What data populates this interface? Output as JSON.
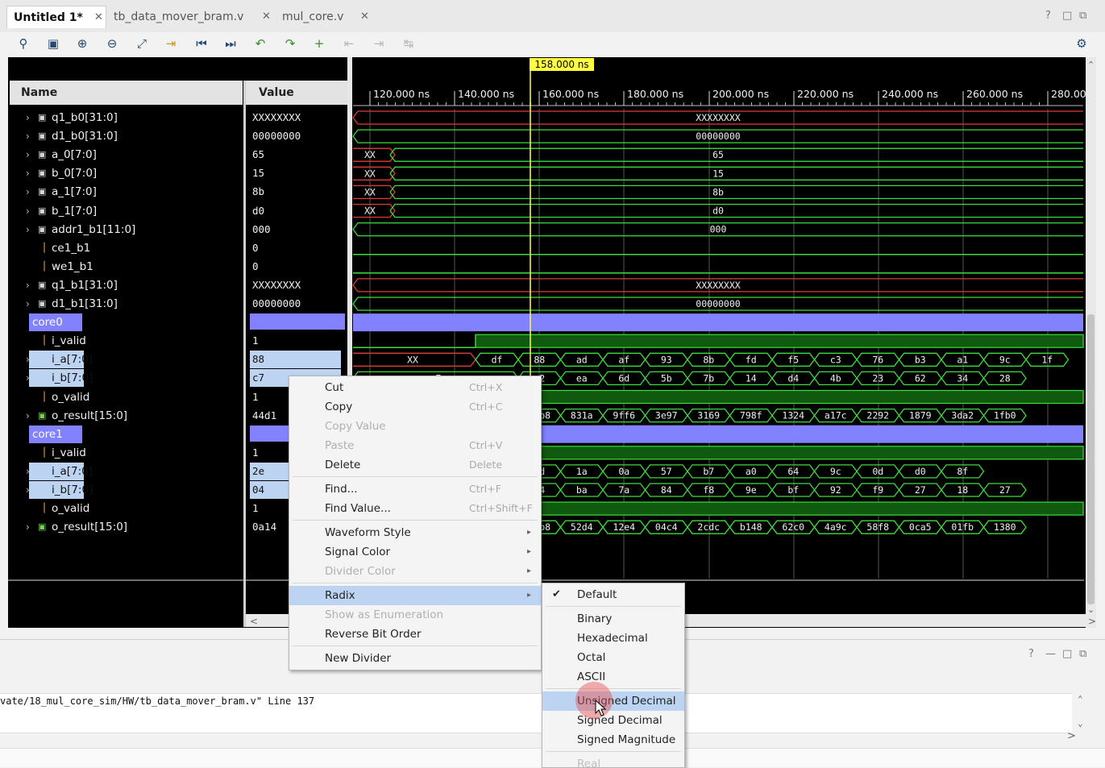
{
  "tabs": [
    {
      "label": "Untitled 1*",
      "active": true
    },
    {
      "label": "tb_data_mover_bram.v",
      "active": false
    },
    {
      "label": "mul_core.v",
      "active": false
    }
  ],
  "window_controls": {
    "help": "?",
    "minimize": "—",
    "maximize": "□",
    "restore": "⧉"
  },
  "toolbar": {
    "icons": [
      "search-icon",
      "save-icon",
      "zoom-in-icon",
      "zoom-out-icon",
      "zoom-fit-icon",
      "go-to-cursor-icon",
      "go-to-start-icon",
      "go-to-end-icon",
      "previous-transition-icon",
      "next-transition-icon",
      "add-marker-icon",
      "previous-marker-icon",
      "next-marker-icon",
      "swap-cursors-icon"
    ],
    "settings_icon": "gear-icon"
  },
  "wave": {
    "name_header": "Name",
    "value_header": "Value",
    "cursor_time": "158.000 ns",
    "ticks": [
      "120.000 ns",
      "140.000 ns",
      "160.000 ns",
      "180.000 ns",
      "200.000 ns",
      "220.000 ns",
      "240.000 ns",
      "260.000 ns",
      "280.00"
    ],
    "signals": [
      {
        "name": "q1_b0[31:0]",
        "value": "XXXXXXXX",
        "kind": "bus",
        "expand": true,
        "wave": "XXXXXXXX",
        "style": "x"
      },
      {
        "name": "d1_b0[31:0]",
        "value": "00000000",
        "kind": "bus",
        "expand": true,
        "wave": "00000000",
        "style": "bus"
      },
      {
        "name": "a_0[7:0]",
        "value": "65",
        "kind": "bus",
        "expand": true,
        "wave": "65",
        "pre": "XX",
        "style": "bus"
      },
      {
        "name": "b_0[7:0]",
        "value": "15",
        "kind": "bus",
        "expand": true,
        "wave": "15",
        "pre": "XX",
        "style": "bus"
      },
      {
        "name": "a_1[7:0]",
        "value": "8b",
        "kind": "bus",
        "expand": true,
        "wave": "8b",
        "pre": "XX",
        "style": "bus"
      },
      {
        "name": "b_1[7:0]",
        "value": "d0",
        "kind": "bus",
        "expand": true,
        "wave": "d0",
        "pre": "XX",
        "style": "bus"
      },
      {
        "name": "addr1_b1[11:0]",
        "value": "000",
        "kind": "bus",
        "expand": true,
        "wave": "000",
        "style": "bus"
      },
      {
        "name": "ce1_b1",
        "value": "0",
        "kind": "bit",
        "expand": false,
        "style": "low"
      },
      {
        "name": "we1_b1",
        "value": "0",
        "kind": "bit",
        "expand": false,
        "style": "low"
      },
      {
        "name": "q1_b1[31:0]",
        "value": "XXXXXXXX",
        "kind": "bus",
        "expand": true,
        "wave": "XXXXXXXX",
        "style": "x"
      },
      {
        "name": "d1_b1[31:0]",
        "value": "00000000",
        "kind": "bus",
        "expand": true,
        "wave": "00000000",
        "style": "bus"
      },
      {
        "name": "core0",
        "value": "",
        "kind": "divider",
        "expand": false,
        "style": "divider"
      },
      {
        "name": "i_valid",
        "value": "1",
        "kind": "bit",
        "expand": false,
        "style": "high"
      },
      {
        "name": "i_a[7:0]",
        "value": "88",
        "kind": "bus",
        "expand": true,
        "selected": true,
        "pre": "XX",
        "segs": [
          "df",
          "88",
          "ad",
          "af",
          "93",
          "8b",
          "fd",
          "f5",
          "c3",
          "76",
          "b3",
          "a1",
          "9c",
          "1f"
        ],
        "style": "segs"
      },
      {
        "name": "i_b[7:0]",
        "value": "c7",
        "kind": "bus",
        "expand": true,
        "selected": true,
        "segs": [
          "c7",
          "c2",
          "ea",
          "6d",
          "5b",
          "7b",
          "14",
          "d4",
          "4b",
          "23",
          "62",
          "34",
          "28"
        ],
        "style": "segs"
      },
      {
        "name": "o_valid",
        "value": "1",
        "kind": "bit",
        "expand": false,
        "style": "high"
      },
      {
        "name": "o_result[15:0]",
        "value": "44d1",
        "kind": "bus",
        "expand": true,
        "segs": [
          "44d1",
          "69b8",
          "831a",
          "9ff6",
          "3e97",
          "3169",
          "798f",
          "1324",
          "a17c",
          "2292",
          "1879",
          "3da2",
          "1fb0"
        ],
        "style": "segs"
      },
      {
        "name": "core1",
        "value": "",
        "kind": "divider",
        "expand": false,
        "style": "divider"
      },
      {
        "name": "i_valid",
        "value": "1",
        "kind": "bit",
        "expand": false,
        "style": "high"
      },
      {
        "name": "i_a[7:0]",
        "value": "2e",
        "kind": "bus",
        "expand": true,
        "selected": true,
        "segs": [
          "2e",
          "5d",
          "1a",
          "0a",
          "57",
          "b7",
          "a0",
          "64",
          "9c",
          "0d",
          "d0",
          "8f"
        ],
        "style": "segs"
      },
      {
        "name": "i_b[7:0]",
        "value": "04",
        "kind": "bus",
        "expand": true,
        "selected": true,
        "segs": [
          "04",
          "e4",
          "ba",
          "7a",
          "84",
          "f8",
          "9e",
          "bf",
          "92",
          "f9",
          "27",
          "18",
          "27"
        ],
        "style": "segs"
      },
      {
        "name": "o_valid",
        "value": "1",
        "kind": "bit",
        "expand": false,
        "style": "high"
      },
      {
        "name": "o_result[15:0]",
        "value": "0a14",
        "kind": "bus",
        "expand": true,
        "segs": [
          "0a14",
          "00b8",
          "52d4",
          "12e4",
          "04c4",
          "2cdc",
          "b148",
          "62c0",
          "4a9c",
          "58f8",
          "0ca5",
          "01fb",
          "1380"
        ],
        "style": "segs"
      }
    ]
  },
  "context_menu": {
    "items": [
      {
        "label": "Cut",
        "shortcut": "Ctrl+X",
        "disabled": false,
        "sep_after": false
      },
      {
        "label": "Copy",
        "shortcut": "Ctrl+C",
        "disabled": false,
        "sep_after": false
      },
      {
        "label": "Copy Value",
        "shortcut": "",
        "disabled": true,
        "sep_after": false
      },
      {
        "label": "Paste",
        "shortcut": "Ctrl+V",
        "disabled": true,
        "sep_after": false
      },
      {
        "label": "Delete",
        "shortcut": "Delete",
        "disabled": false,
        "sep_after": true
      },
      {
        "label": "Find...",
        "shortcut": "Ctrl+F",
        "disabled": false,
        "sep_after": false
      },
      {
        "label": "Find Value...",
        "shortcut": "Ctrl+Shift+F",
        "disabled": false,
        "sep_after": true
      },
      {
        "label": "Waveform Style",
        "shortcut": "",
        "disabled": false,
        "submenu": true,
        "sep_after": false
      },
      {
        "label": "Signal Color",
        "shortcut": "",
        "disabled": false,
        "submenu": true,
        "sep_after": false
      },
      {
        "label": "Divider Color",
        "shortcut": "",
        "disabled": true,
        "submenu": true,
        "sep_after": true
      },
      {
        "label": "Radix",
        "shortcut": "",
        "disabled": false,
        "submenu": true,
        "active": true,
        "sep_after": false
      },
      {
        "label": "Show as Enumeration",
        "shortcut": "",
        "disabled": true,
        "sep_after": false
      },
      {
        "label": "Reverse Bit Order",
        "shortcut": "",
        "disabled": false,
        "sep_after": true
      },
      {
        "label": "New Divider",
        "shortcut": "",
        "disabled": false,
        "sep_after": false
      }
    ]
  },
  "radix_menu": {
    "items": [
      {
        "label": "Default",
        "checked": true,
        "sep_after": true
      },
      {
        "label": "Binary"
      },
      {
        "label": "Hexadecimal"
      },
      {
        "label": "Octal"
      },
      {
        "label": "ASCII",
        "sep_after": true
      },
      {
        "label": "Unsigned Decimal",
        "active": true
      },
      {
        "label": "Signed Decimal"
      },
      {
        "label": "Signed Magnitude",
        "sep_after": true
      },
      {
        "label": "Real",
        "disabled": true
      }
    ]
  },
  "bottom_panel": {
    "log_text": "vate/18_mul_core_sim/HW/tb_data_mover_bram.v\" Line 137"
  }
}
